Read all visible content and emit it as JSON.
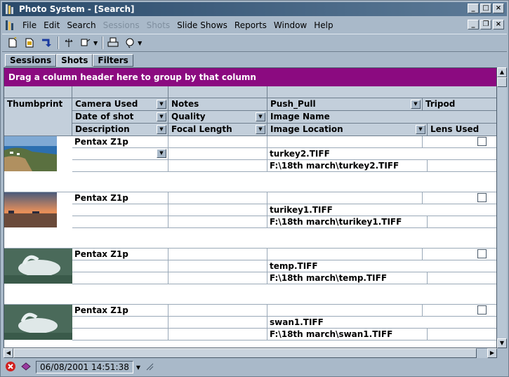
{
  "window": {
    "title": "Photo System - [Search]"
  },
  "menu": [
    "File",
    "Edit",
    "Search",
    "Sessions",
    "Shots",
    "Slide Shows",
    "Reports",
    "Window",
    "Help"
  ],
  "menu_disabled": [
    "Sessions",
    "Shots"
  ],
  "tabs": [
    "Sessions",
    "Shots",
    "Filters"
  ],
  "active_tab": "Shots",
  "grid": {
    "group_hint": "Drag a column header here to group by that column",
    "headers": {
      "thumbprint": "Thumbprint",
      "camera": "Camera Used",
      "notes": "Notes",
      "push_pull": "Push_Pull",
      "tripod": "Tripod",
      "date": "Date of shot",
      "quality": "Quality",
      "image_name": "Image Name",
      "description": "Description",
      "focal": "Focal Length",
      "location": "Image Location",
      "lens": "Lens Used"
    },
    "records": [
      {
        "camera": "Pentax Z1p",
        "image_name": "turkey2.TIFF",
        "location": "F:\\18th march\\turkey2.TIFF"
      },
      {
        "camera": "Pentax Z1p",
        "image_name": "turikey1.TIFF",
        "location": "F:\\18th march\\turikey1.TIFF"
      },
      {
        "camera": "Pentax Z1p",
        "image_name": "temp.TIFF",
        "location": "F:\\18th march\\temp.TIFF"
      },
      {
        "camera": "Pentax Z1p",
        "image_name": "swan1.TIFF",
        "location": "F:\\18th march\\swan1.TIFF"
      }
    ]
  },
  "status": {
    "datetime": "06/08/2001 14:51:38"
  },
  "colors": {
    "group_bar": "#8b0a80",
    "header": "#c3cfdb",
    "background": "#a9b9c9"
  }
}
